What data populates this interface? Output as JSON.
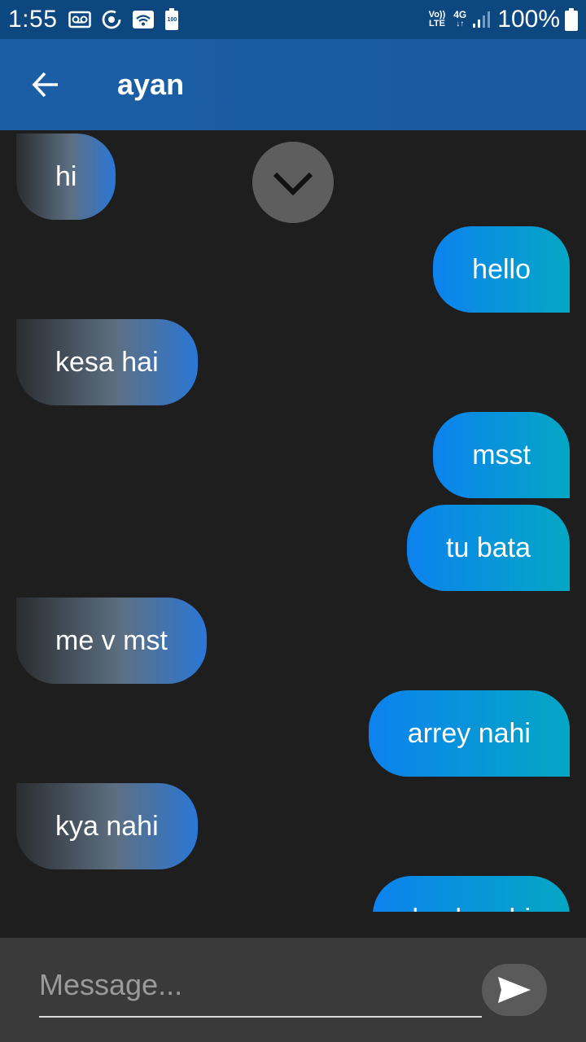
{
  "status_bar": {
    "time": "1:55",
    "volte_line1": "Vo))",
    "volte_line2": "LTE",
    "network_type": "4G",
    "battery_percent": "100%",
    "battery_saver_label": "100",
    "icons": [
      "voicemail-icon",
      "data-saver-icon",
      "wifi-icon",
      "battery-saver-icon",
      "volte-icon",
      "network-4g-icon",
      "signal-icon",
      "battery-icon"
    ]
  },
  "app_bar": {
    "title": "ayan",
    "back_icon": "arrow-left-icon"
  },
  "messages": [
    {
      "direction": "in",
      "text": "hi"
    },
    {
      "direction": "out",
      "text": "hello"
    },
    {
      "direction": "in",
      "text": "kesa hai"
    },
    {
      "direction": "out",
      "text": "msst"
    },
    {
      "direction": "out",
      "text": "tu bata"
    },
    {
      "direction": "in",
      "text": "me v mst"
    },
    {
      "direction": "out",
      "text": "arrey nahi"
    },
    {
      "direction": "in",
      "text": "kya nahi"
    },
    {
      "direction": "out",
      "text": "kuch nahi"
    }
  ],
  "scroll_button": {
    "icon": "chevron-down-icon"
  },
  "composer": {
    "placeholder": "Message...",
    "value": "",
    "send_icon": "send-icon"
  },
  "colors": {
    "status_bar": "#0d4780",
    "app_bar": "#1b5ea6",
    "background": "#1e1e1e",
    "incoming_start": "#2a2d30",
    "incoming_end": "#2b77d6",
    "outgoing_start": "#0c82ee",
    "outgoing_end": "#04a7c4",
    "composer": "#3a3a3a"
  }
}
